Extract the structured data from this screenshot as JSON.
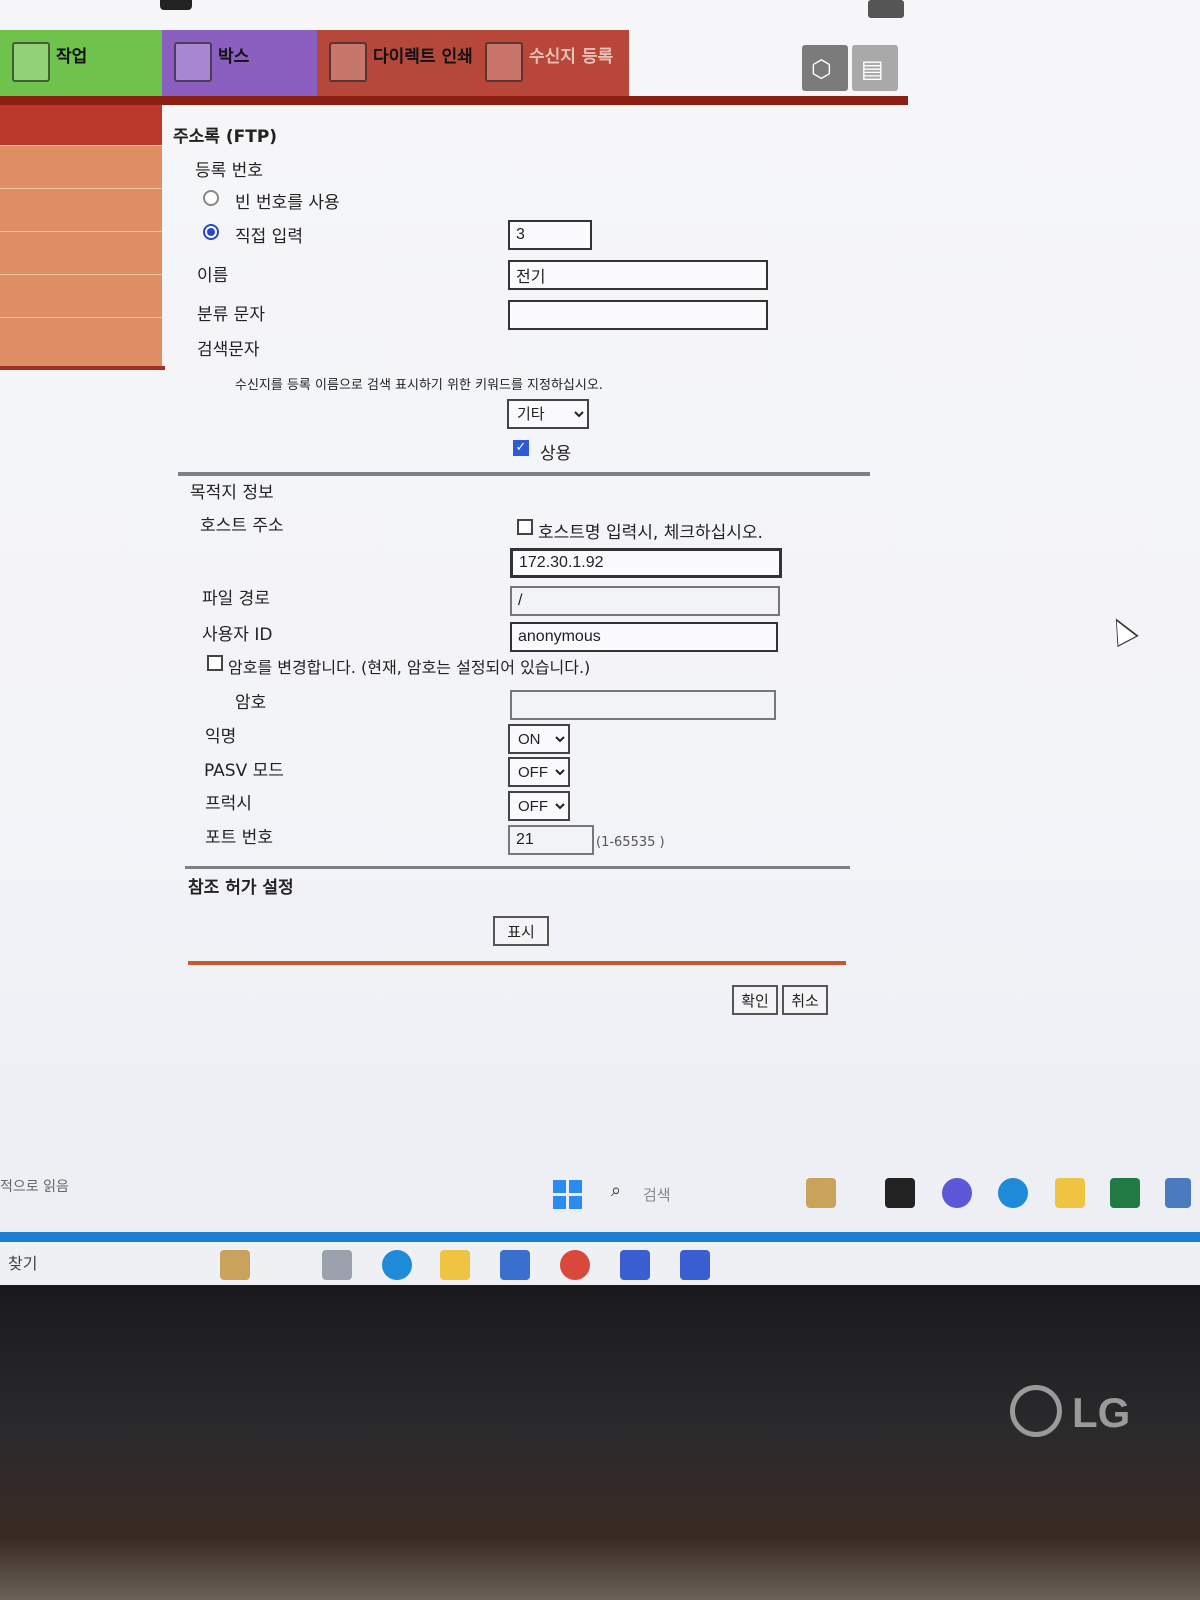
{
  "tabs": {
    "job": "작업",
    "box": "박스",
    "direct_print": "다이렉트 인쇄",
    "register": "수신지 등록"
  },
  "form": {
    "section_title": "주소록 (FTP)",
    "reg_number_label": "등록 번호",
    "use_empty_number": "빈 번호를 사용",
    "direct_input": "직접 입력",
    "reg_number_value": "3",
    "name_label": "이름",
    "name_value": "전기",
    "category_label": "분류 문자",
    "category_value": "",
    "search_label": "검색문자",
    "search_hint": "수신지를 등록 이름으로 검색 표시하기 위한 키워드를 지정하십시오.",
    "search_select": "기타",
    "common_label": "상용",
    "common_checked": true
  },
  "destination": {
    "section_title": "목적지 정보",
    "host_label": "호스트 주소",
    "hostname_check": "호스트명 입력시, 체크하십시오.",
    "host_value": "172.30.1.92",
    "path_label": "파일 경로",
    "path_value": "/",
    "user_label": "사용자 ID",
    "user_value": "anonymous",
    "change_password": "암호를 변경합니다. (현재, 암호는 설정되어 있습니다.)",
    "password_label": "암호",
    "anonymous_label": "익명",
    "anonymous_value": "ON",
    "pasv_label": "PASV 모드",
    "pasv_value": "OFF",
    "proxy_label": "프럭시",
    "proxy_value": "OFF",
    "port_label": "포트 번호",
    "port_value": "21",
    "port_range": "(1-65535 )"
  },
  "reference": {
    "section_title": "참조 허가 설정",
    "show_button": "표시"
  },
  "actions": {
    "ok": "확인",
    "cancel": "취소"
  },
  "taskbar": {
    "status_text": "적으로 읽음",
    "search_placeholder": "검색",
    "find_label": "찾기"
  },
  "monitor": {
    "brand": "LG"
  }
}
